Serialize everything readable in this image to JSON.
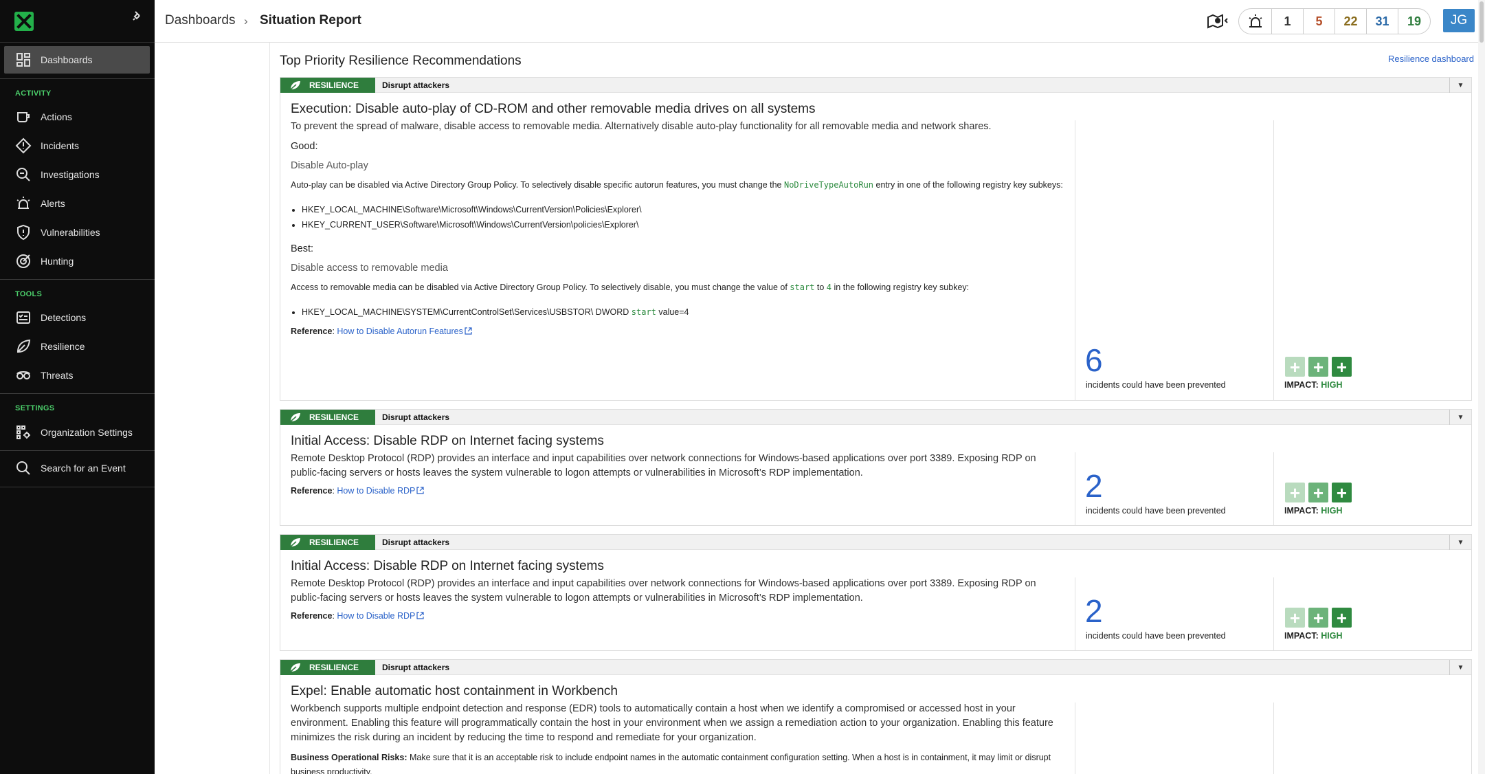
{
  "sidebar": {
    "dashboards": "Dashboards",
    "activity_label": "ACTIVITY",
    "activity": [
      "Actions",
      "Incidents",
      "Investigations",
      "Alerts",
      "Vulnerabilities",
      "Hunting"
    ],
    "tools_label": "TOOLS",
    "tools": [
      "Detections",
      "Resilience",
      "Threats"
    ],
    "settings_label": "SETTINGS",
    "settings": [
      "Organization Settings"
    ],
    "search": "Search for an Event"
  },
  "header": {
    "breadcrumb_root": "Dashboards",
    "breadcrumb_sep": "›",
    "breadcrumb_current": "Situation Report",
    "counters": [
      "1",
      "5",
      "22",
      "31",
      "19"
    ],
    "counter_colors": [
      "#333333",
      "#b5502b",
      "#8a6d1e",
      "#2b6aa8",
      "#2f7d3d"
    ],
    "avatar": "JG"
  },
  "main": {
    "title": "Top Priority Resilience Recommendations",
    "dashboard_link": "Resilience dashboard",
    "cards": [
      {
        "tag": "RESILIENCE",
        "category": "Disrupt attackers",
        "title": "Execution: Disable auto-play of CD-ROM and other removable media drives on all systems",
        "desc": "To prevent the spread of malware, disable access to removable media. Alternatively disable auto-play functionality for all removable media and network shares.",
        "good_label": "Good",
        "good_title": "Disable Auto-play",
        "good_text_1": "Auto-play can be disabled via Active Directory Group Policy. To selectively disable specific autorun features, you must change the ",
        "good_code": "NoDriveTypeAutoRun",
        "good_text_2": " entry in one of the following registry key subkeys:",
        "good_keys": [
          "HKEY_LOCAL_MACHINE\\Software\\Microsoft\\Windows\\CurrentVersion\\Policies\\Explorer\\",
          "HKEY_CURRENT_USER\\Software\\Microsoft\\Windows\\CurrentVersion\\policies\\Explorer\\"
        ],
        "best_label": "Best",
        "best_title": "Disable access to removable media",
        "best_text_1": "Access to removable media can be disabled via Active Directory Group Policy. To selectively disable, you must change the value of ",
        "best_code_1": "start",
        "best_text_2": " to ",
        "best_code_2": "4",
        "best_text_3": " in the following registry key subkey:",
        "best_key_1": "HKEY_LOCAL_MACHINE\\SYSTEM\\CurrentControlSet\\Services\\USBSTOR\\ DWORD ",
        "best_key_code": "start",
        "best_key_2": " value=4",
        "ref_label": "Reference",
        "ref_link": "How to Disable Autorun Features",
        "count": "6",
        "count_label": "incidents could have been prevented",
        "impact_label": "IMPACT:",
        "impact_value": "HIGH"
      },
      {
        "tag": "RESILIENCE",
        "category": "Disrupt attackers",
        "title": "Initial Access: Disable RDP on Internet facing systems",
        "desc": "Remote Desktop Protocol (RDP) provides an interface and input capabilities over network connections for Windows-based applications over port 3389. Exposing RDP on public-facing servers or hosts leaves the system vulnerable to logon attempts or vulnerabilities in Microsoft’s RDP implementation.",
        "ref_label": "Reference",
        "ref_link": "How to Disable RDP",
        "count": "2",
        "count_label": "incidents could have been prevented",
        "impact_label": "IMPACT:",
        "impact_value": "HIGH"
      },
      {
        "tag": "RESILIENCE",
        "category": "Disrupt attackers",
        "title": "Initial Access: Disable RDP on Internet facing systems",
        "desc": "Remote Desktop Protocol (RDP) provides an interface and input capabilities over network connections for Windows-based applications over port 3389. Exposing RDP on public-facing servers or hosts leaves the system vulnerable to logon attempts or vulnerabilities in Microsoft’s RDP implementation.",
        "ref_label": "Reference",
        "ref_link": "How to Disable RDP",
        "count": "2",
        "count_label": "incidents could have been prevented",
        "impact_label": "IMPACT:",
        "impact_value": "HIGH"
      },
      {
        "tag": "RESILIENCE",
        "category": "Disrupt attackers",
        "title": "Expel: Enable automatic host containment in Workbench",
        "desc": "Workbench supports multiple endpoint detection and response (EDR) tools to automatically contain a host when we identify a compromised or accessed host in your environment. Enabling this feature will programmatically contain the host in your environment when we assign a remediation action to your organization. Enabling this feature minimizes the risk during an incident by reducing the time to respond and remediate for your organization.",
        "risk_label": "Business Operational Risks:",
        "risk_text": " Make sure that it is an acceptable risk to include endpoint names in the automatic containment configuration setting. When a host is in containment, it may limit or disrupt business productivity."
      }
    ]
  }
}
